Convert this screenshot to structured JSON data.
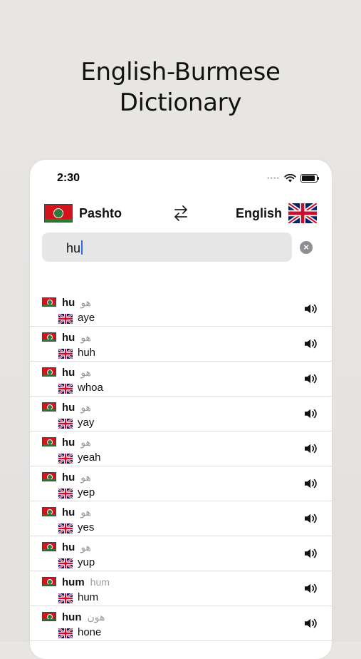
{
  "headline": [
    "English-Burmese",
    "Dictionary"
  ],
  "status": {
    "time": "2:30"
  },
  "lang_bar": {
    "from": "Pashto",
    "to": "English"
  },
  "search": {
    "value": "hu"
  },
  "results": [
    {
      "term": "hu",
      "native": "هو",
      "translation": "aye"
    },
    {
      "term": "hu",
      "native": "هو",
      "translation": "huh"
    },
    {
      "term": "hu",
      "native": "هو",
      "translation": "whoa"
    },
    {
      "term": "hu",
      "native": "هو",
      "translation": "yay"
    },
    {
      "term": "hu",
      "native": "هو",
      "translation": "yeah"
    },
    {
      "term": "hu",
      "native": "هو",
      "translation": "yep"
    },
    {
      "term": "hu",
      "native": "هو",
      "translation": "yes"
    },
    {
      "term": "hu",
      "native": "هو",
      "translation": "yup"
    },
    {
      "term": "hum",
      "native": "hum",
      "translation": "hum"
    },
    {
      "term": "hun",
      "native": "هون",
      "translation": "hone"
    }
  ]
}
